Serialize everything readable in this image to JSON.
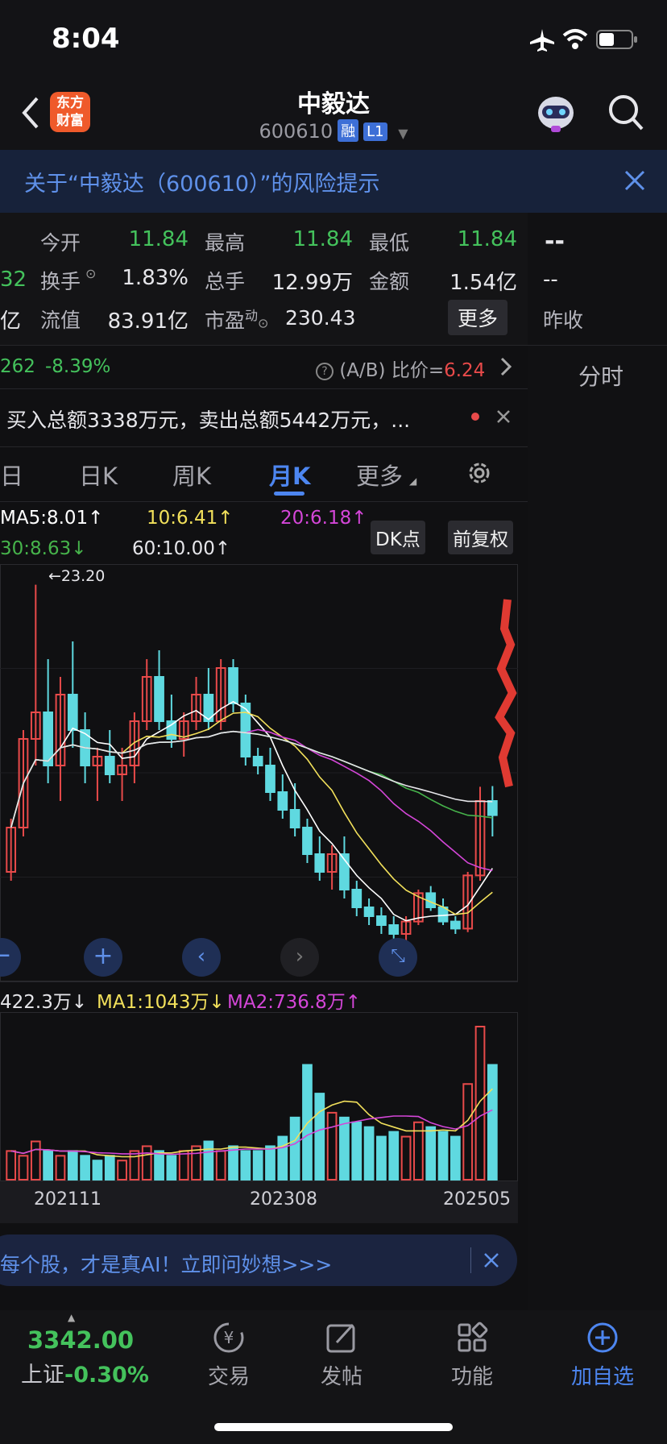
{
  "status_bar": {
    "time": "8:04"
  },
  "header": {
    "logo_text_top": "东方",
    "logo_text_bottom": "财富",
    "title": "中毅达",
    "code": "600610",
    "tag_margin": "融",
    "tag_level": "L1"
  },
  "risk_banner": {
    "text": "关于“中毅达（600610）”的风险提示"
  },
  "quote": {
    "row1": [
      {
        "label": "今开",
        "value": "11.84"
      },
      {
        "label": "最高",
        "value": "11.84"
      },
      {
        "label": "最低",
        "value": "11.84"
      }
    ],
    "row2": [
      {
        "label": "换手",
        "value": "1.83%"
      },
      {
        "label": "总手",
        "value": "12.99万"
      },
      {
        "label": "金额",
        "value": "1.54亿"
      }
    ],
    "row3": [
      {
        "label": "流值",
        "value": "83.91亿"
      },
      {
        "label": "市盈",
        "sup": "动",
        "value": "230.43"
      }
    ],
    "left_edge_row2": "32",
    "left_edge_row3": "亿",
    "more_button": "更多",
    "side_top": "--",
    "side_mid": "--",
    "side_bottom": "昨收",
    "colors": {
      "up": "#e84a4a",
      "down": "#44c25c"
    }
  },
  "ab_row": {
    "left_value": "262",
    "change": "-8.39%",
    "ratio_label": "(A/B) 比价=",
    "ratio_value": "6.24"
  },
  "fenshi": "分时",
  "news_row": {
    "text": "买入总额3338万元，卖出总额5442万元，..."
  },
  "tabs": [
    {
      "label": "日"
    },
    {
      "label": "日K"
    },
    {
      "label": "周K"
    },
    {
      "label": "月K",
      "active": true
    },
    {
      "label": "更多"
    }
  ],
  "ma_legend": {
    "ma5": "MA5:8.01↑",
    "ma10": "10:6.41↑",
    "ma20": "20:6.18↑",
    "ma30": "30:8.63↓",
    "ma60": "60:10.00↑",
    "dk_button": "DK点",
    "fq_button": "前复权",
    "colors": {
      "ma5": "#ffffff",
      "ma10": "#f2e05b",
      "ma20": "#d446d8",
      "ma30": "#46b34b",
      "ma60": "#ffffff"
    }
  },
  "chart_annotation": "←23.20",
  "volume_legend": {
    "vol": "422.3万↓",
    "ma1": "MA1:1043万↓",
    "ma2": "MA2:736.8万↑"
  },
  "x_labels": [
    "202111",
    "202308",
    "202505"
  ],
  "promo": {
    "text": "每个股，才是真AI！立即问妙想>>>"
  },
  "footer": {
    "index_value": "3342.00",
    "index_name": "上证",
    "index_change": "-0.30%",
    "items": [
      {
        "label": "交易",
        "icon": "trade-icon"
      },
      {
        "label": "发帖",
        "icon": "post-icon"
      },
      {
        "label": "功能",
        "icon": "grid-icon"
      },
      {
        "label": "加自选",
        "icon": "add-watchlist-icon"
      }
    ]
  },
  "chart_data": {
    "type": "candlestick",
    "x_labels": [
      "202111",
      "202308",
      "202505"
    ],
    "ylim": [
      3,
      24
    ],
    "max_annotation": 23.2,
    "candles": [
      [
        7,
        10,
        6.5,
        9.5
      ],
      [
        9.5,
        15,
        9,
        14.5
      ],
      [
        14.5,
        23.2,
        13,
        16
      ],
      [
        16,
        19,
        12,
        13
      ],
      [
        13,
        18,
        11,
        17
      ],
      [
        17,
        20,
        14,
        15
      ],
      [
        15,
        16,
        12,
        13
      ],
      [
        13,
        14,
        11,
        13.5
      ],
      [
        13.5,
        15,
        12,
        12.5
      ],
      [
        12.5,
        14,
        11,
        13
      ],
      [
        13,
        16,
        12,
        15.5
      ],
      [
        15.5,
        19,
        15,
        18
      ],
      [
        18,
        19.5,
        15,
        15.5
      ],
      [
        15.5,
        17,
        14,
        14.5
      ],
      [
        14.5,
        16,
        13.5,
        15.5
      ],
      [
        15.5,
        18,
        15,
        17
      ],
      [
        17,
        18.5,
        15,
        15.5
      ],
      [
        15.5,
        19,
        15,
        18.5
      ],
      [
        18.5,
        19,
        16,
        16.5
      ],
      [
        16.5,
        17,
        13,
        13.5
      ],
      [
        13.5,
        14,
        12.5,
        13
      ],
      [
        13,
        14,
        11,
        11.5
      ],
      [
        11.5,
        12.5,
        10,
        10.5
      ],
      [
        10.5,
        12,
        9,
        9.5
      ],
      [
        9.5,
        10,
        7.5,
        8
      ],
      [
        8,
        9,
        6.5,
        7
      ],
      [
        7,
        8.5,
        6,
        8
      ],
      [
        8,
        9,
        5.5,
        6
      ],
      [
        6,
        6.5,
        4.5,
        5
      ],
      [
        5,
        5.5,
        4,
        4.5
      ],
      [
        4.5,
        5,
        3.5,
        4
      ],
      [
        4,
        4.5,
        3.2,
        3.5
      ],
      [
        3.5,
        4.5,
        3,
        4.2
      ],
      [
        4.2,
        6,
        4,
        5.8
      ],
      [
        5.8,
        6.2,
        4.8,
        5
      ],
      [
        5,
        5.5,
        4,
        4.2
      ],
      [
        4.2,
        4.5,
        3.5,
        3.8
      ],
      [
        3.8,
        7,
        3.6,
        6.8
      ],
      [
        6.8,
        11.8,
        6.5,
        11
      ],
      [
        11,
        11.84,
        9,
        10.2
      ]
    ],
    "volume": [
      3,
      2.5,
      4,
      3,
      2.5,
      3,
      2.5,
      2,
      2.5,
      2,
      3,
      3.5,
      3,
      2.5,
      3,
      3.5,
      4,
      3,
      3.5,
      3,
      3,
      3.5,
      4.5,
      6.5,
      12,
      9,
      7,
      6.5,
      6,
      5.5,
      4.5,
      5,
      4.5,
      6,
      5.5,
      5,
      4.5,
      10,
      16,
      12
    ],
    "volume_colors": [
      "u",
      "u",
      "u",
      "d",
      "u",
      "d",
      "d",
      "d",
      "d",
      "u",
      "u",
      "u",
      "d",
      "d",
      "u",
      "u",
      "d",
      "u",
      "d",
      "d",
      "d",
      "d",
      "d",
      "d",
      "d",
      "d",
      "u",
      "d",
      "d",
      "d",
      "d",
      "d",
      "u",
      "u",
      "d",
      "d",
      "d",
      "u",
      "u",
      "d"
    ]
  }
}
